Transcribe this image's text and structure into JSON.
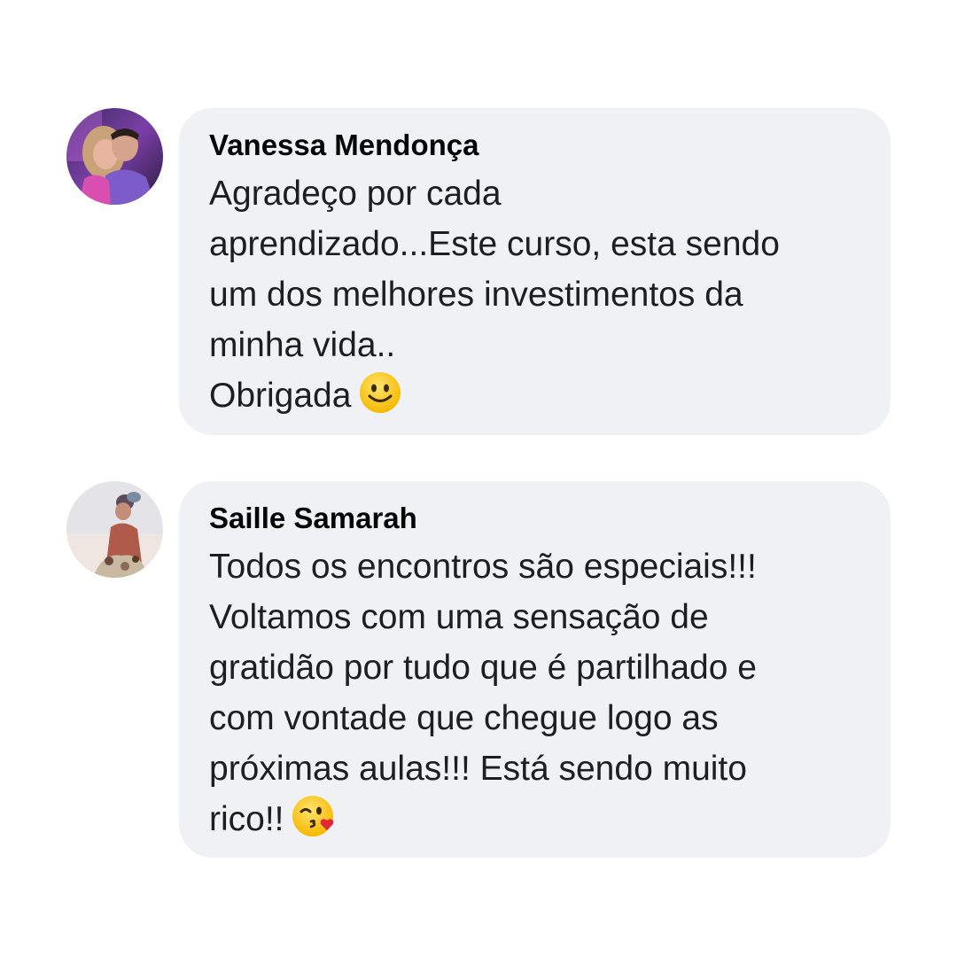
{
  "comments": [
    {
      "author": "Vanessa Mendonça",
      "avatar_icon": "profile-photo-couple",
      "lines": [
        "Agradeço por cada",
        "aprendizado...Este curso, esta sendo",
        "um dos melhores investimentos da",
        "minha vida..",
        "Obrigada"
      ],
      "trailing_emoji": "slightly-smiling-face-emoji"
    },
    {
      "author": "Saille Samarah",
      "avatar_icon": "profile-photo-person",
      "lines": [
        "Todos os encontros são especiais!!!",
        "Voltamos com uma sensação de",
        "gratidão por tudo que é partilhado e",
        "com vontade que chegue logo as",
        "próximas aulas!!! Está sendo muito",
        "rico!!"
      ],
      "trailing_emoji": "face-blowing-kiss-emoji"
    }
  ],
  "colors": {
    "bubble_background": "#eff1f4",
    "author_text": "#050505",
    "body_text": "#1c1e21",
    "page_background": "#ffffff"
  }
}
